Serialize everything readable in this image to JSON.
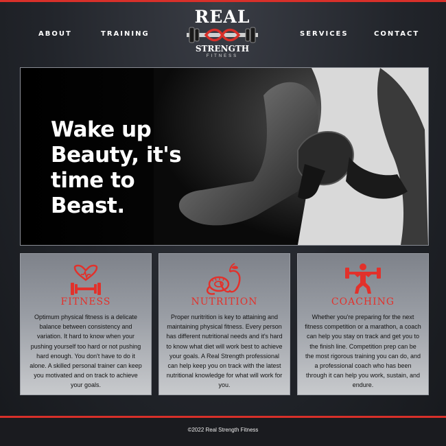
{
  "nav": {
    "about": "ABOUT",
    "training": "TRAINING",
    "services": "SERVICES",
    "contact": "CONTACT"
  },
  "logo": {
    "line1": "REAL",
    "line2": "STRENGTH",
    "line3": "FITNESS"
  },
  "hero": {
    "headline_lines": [
      "Wake up",
      "Beauty, it's",
      "time to Beast."
    ]
  },
  "cards": [
    {
      "icon": "heart-dumbbell-icon",
      "title": "FITNESS",
      "text": "Optimum physical fitness is a delicate balance between consistency and variation. It hard to know when your pushing yourself too hard or not pushing hard enough. You don't have to do it alone. A skilled personal trainer can keep you motivated and on track to achieve your goals."
    },
    {
      "icon": "apple-tape-icon",
      "title": "NUTRITION",
      "text": "Proper nuritrition is key to attaining and maintaining physical fitness. Every person has different nutritional needs and it's hard to know what diet will work best to achieve your goals. A Real Strength professional can help keep you on track with the latest nutritional knowledge for what will work for you."
    },
    {
      "icon": "weightlifter-icon",
      "title": "COACHING",
      "text": "Whether you're preparing for the next fitness competition or a marathon, a coach can help you stay on track and get you to the finish line. Competition prep can be the most rigorous training you can do, and a professional coach who has been through it can help you work, sustain, and endure."
    }
  ],
  "footer": {
    "copyright": "©2022 Real Strength Fitness"
  },
  "colors": {
    "accent": "#d8302a",
    "background": "#22252b"
  }
}
